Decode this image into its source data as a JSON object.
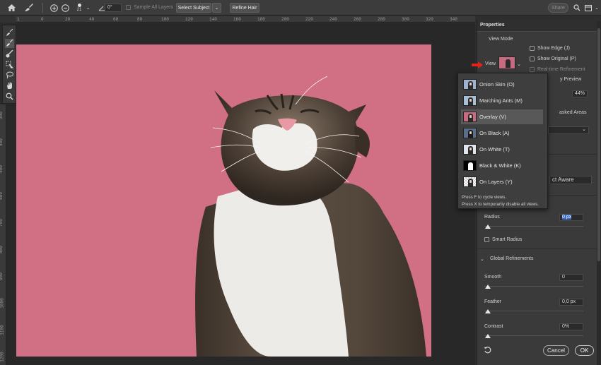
{
  "options_bar": {
    "brush_size": "21",
    "angle": "0°",
    "sample_all_layers": "Sample All Layers",
    "select_subject": "Select Subject",
    "refine_hair": "Refine Hair",
    "share": "Share"
  },
  "rulers": {
    "top": [
      "1",
      "0",
      "20",
      "40",
      "60",
      "80",
      "100",
      "120",
      "140",
      "160",
      "180",
      "200",
      "220",
      "240",
      "260",
      "280",
      "300",
      "320",
      "340"
    ],
    "left": [
      "300",
      "400",
      "500",
      "600",
      "700",
      "800",
      "900",
      "1000",
      "1100",
      "1200"
    ]
  },
  "properties": {
    "tab_label": "Properties",
    "view_mode_heading": "View Mode",
    "view_label": "View",
    "show_edge": "Show Edge (J)",
    "show_original": "Show Original (P)",
    "realtime_refinement": "Real-time Refinement",
    "high_quality_preview_partial": "y Preview",
    "opacity_value": "44%",
    "masked_areas_partial": "asked Areas",
    "object_aware_partial": "ct Aware",
    "radius_label": "Radius",
    "radius_value": "0 px",
    "smart_radius": "Smart Radius",
    "global_refinements": "Global Refinements",
    "smooth_label": "Smooth",
    "smooth_value": "0",
    "feather_label": "Feather",
    "feather_value": "0,0 px",
    "contrast_label": "Contrast",
    "contrast_value": "0%",
    "cancel": "Cancel",
    "ok": "OK"
  },
  "view_dropdown": {
    "items": [
      {
        "label": "Onion Skin (O)",
        "thumb": "onion-skin"
      },
      {
        "label": "Marching Ants (M)",
        "thumb": "marching-ants"
      },
      {
        "label": "Overlay (V)",
        "thumb": "overlay"
      },
      {
        "label": "On Black (A)",
        "thumb": "on-black"
      },
      {
        "label": "On White (T)",
        "thumb": "on-white"
      },
      {
        "label": "Black & White (K)",
        "thumb": "black-white"
      },
      {
        "label": "On Layers (Y)",
        "thumb": "on-layers"
      }
    ],
    "selected_index": 2,
    "help_1": "Press F to cycle views.",
    "help_2": "Press X to temporarily disable all views."
  },
  "colors": {
    "overlay_pink": "#d16f84",
    "selected_item_bg": "#585858",
    "arrow_red": "#e0231c"
  }
}
